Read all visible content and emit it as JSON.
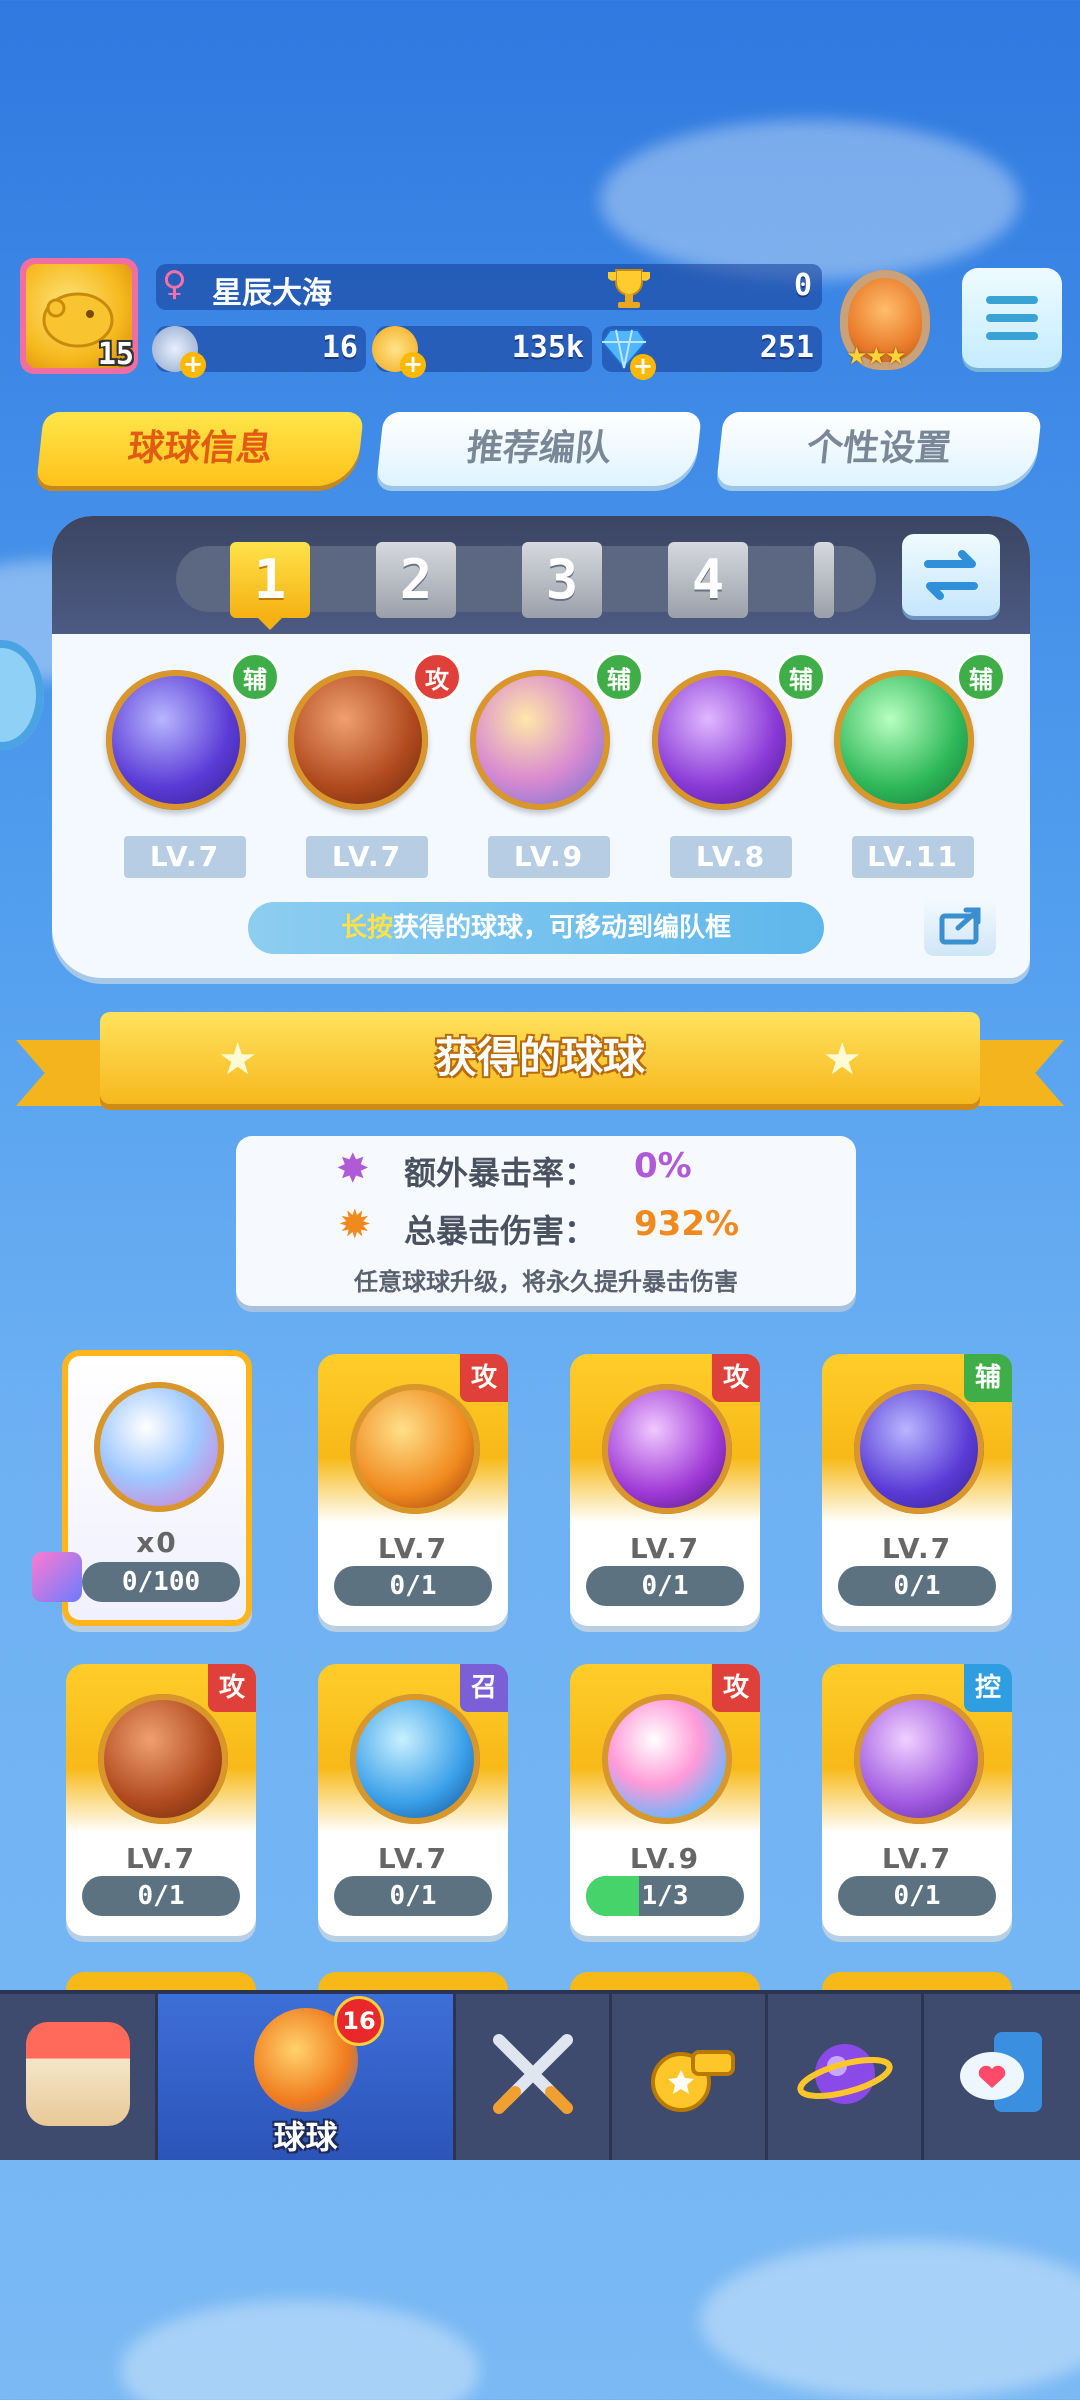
{
  "player": {
    "level": "15",
    "gender_symbol": "♀",
    "name": "星辰大海",
    "trophies": "0",
    "stamina": "16",
    "coins": "135k",
    "gems": "251"
  },
  "tabs": [
    {
      "label": "球球信息",
      "active": true
    },
    {
      "label": "推荐编队",
      "active": false
    },
    {
      "label": "个性设置",
      "active": false
    }
  ],
  "team": {
    "slots": [
      "1",
      "2",
      "3",
      "4"
    ],
    "active_slot": "1",
    "balls": [
      {
        "tag": "辅",
        "level": "LV.7",
        "icon": "lightning-orb-icon"
      },
      {
        "tag": "攻",
        "level": "LV.7",
        "icon": "infinity-orb-icon"
      },
      {
        "tag": "辅",
        "level": "LV.9",
        "icon": "clone-orb-icon"
      },
      {
        "tag": "辅",
        "level": "LV.8",
        "icon": "sprout-orb-icon"
      },
      {
        "tag": "辅",
        "level": "LV.11",
        "icon": "arrow-up-orb-icon"
      }
    ],
    "hint_bold": "长按",
    "hint_rest": "获得的球球，可移动到编队框"
  },
  "section_title": "获得的球球",
  "stats": {
    "extra_crit_label": "额外暴击率：",
    "extra_crit_value": "0%",
    "total_crit_label": "总暴击伤害：",
    "total_crit_value": "932%",
    "note": "任意球球升级，将永久提升暴击伤害"
  },
  "collection": [
    {
      "special": true,
      "count": "x0",
      "progress": "0/100",
      "progress_frac": 0
    },
    {
      "tag": "攻",
      "level": "LV.7",
      "progress": "0/1",
      "progress_frac": 0
    },
    {
      "tag": "攻",
      "level": "LV.7",
      "progress": "0/1",
      "progress_frac": 0
    },
    {
      "tag": "辅",
      "level": "LV.7",
      "progress": "0/1",
      "progress_frac": 0
    },
    {
      "tag": "攻",
      "level": "LV.7",
      "progress": "0/1",
      "progress_frac": 0
    },
    {
      "tag": "召",
      "level": "LV.7",
      "progress": "0/1",
      "progress_frac": 0
    },
    {
      "tag": "攻",
      "level": "LV.9",
      "progress": "1/3",
      "progress_frac": 0.333
    },
    {
      "tag": "控",
      "level": "LV.7",
      "progress": "0/1",
      "progress_frac": 0
    }
  ],
  "nav": [
    {
      "name": "shop",
      "label": ""
    },
    {
      "name": "balls",
      "label": "球球",
      "badge": "16",
      "active": true
    },
    {
      "name": "battle",
      "label": ""
    },
    {
      "name": "whistle",
      "label": ""
    },
    {
      "name": "planet",
      "label": ""
    },
    {
      "name": "social",
      "label": ""
    }
  ],
  "colors": {
    "attack": "#e0403a",
    "support": "#3fae48",
    "summon": "#7b5fd6",
    "control": "#2e9ee0"
  }
}
